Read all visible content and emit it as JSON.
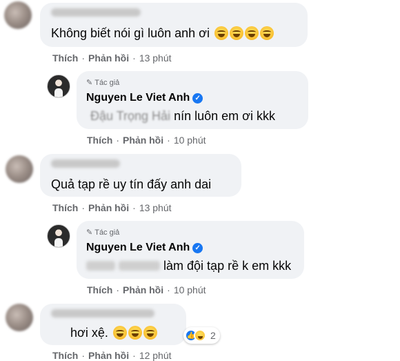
{
  "comments": [
    {
      "text": "Không biết nói gì luôn anh ơi",
      "like_label": "Thích",
      "reply_label": "Phản hồi",
      "time": "13 phút",
      "emoji": "laughing-tears-emoji"
    },
    {
      "author_tag": "Tác giả",
      "author": "Nguyen Le Viet Anh",
      "blurred_prefix": "Đậu Trọng Hải",
      "text": "nín luôn em ơi kkk",
      "like_label": "Thích",
      "reply_label": "Phản hồi",
      "time": "10 phút"
    },
    {
      "text": "Quả tạp rề uy tín đấy anh dai",
      "like_label": "Thích",
      "reply_label": "Phản hồi",
      "time": "13 phút"
    },
    {
      "author_tag": "Tác giả",
      "author": "Nguyen Le Viet Anh",
      "text": "làm đội tạp rề k em kkk",
      "like_label": "Thích",
      "reply_label": "Phản hồi",
      "time": "10 phút"
    },
    {
      "text": "hơi xệ.",
      "like_label": "Thích",
      "reply_label": "Phản hồi",
      "time": "12 phút",
      "reaction_count": "2",
      "emoji": "squinting-laugh-emoji"
    }
  ],
  "colors": {
    "bubble": "#f0f2f5",
    "meta_text": "#65676b",
    "verified_blue": "#1877f2"
  }
}
